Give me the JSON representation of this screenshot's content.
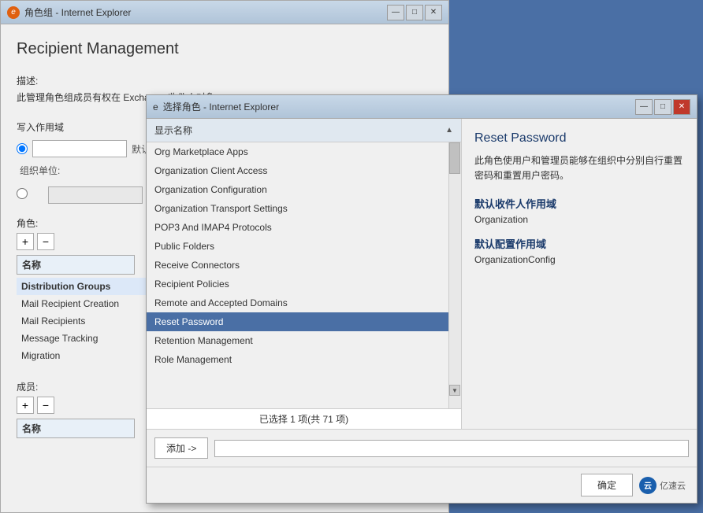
{
  "bg_window": {
    "title": "角色组 - Internet Explorer",
    "ie_icon": "e",
    "content": {
      "heading": "Recipient Management",
      "desc_label": "描述:",
      "desc_text": "此管理角色组成员有权在 Exchange 收件人对象。",
      "write_scope_label": "写入作用域",
      "default_radio": "默认",
      "org_unit_label": "组织单位:",
      "role_label": "角色:",
      "add_symbol": "+",
      "remove_symbol": "−",
      "name_col": "名称",
      "nav_items": [
        {
          "label": "Distribution Groups",
          "active": true
        },
        {
          "label": "Mail Recipient Creation"
        },
        {
          "label": "Mail Recipients"
        },
        {
          "label": "Message Tracking"
        },
        {
          "label": "Migration"
        }
      ],
      "members_label": "成员:",
      "members_add": "+",
      "members_remove": "−",
      "members_name_col": "名称"
    }
  },
  "fg_dialog": {
    "title": "选择角色 - Internet Explorer",
    "ie_icon": "e",
    "list_header": "显示名称",
    "list_items": [
      {
        "label": "Org Marketplace Apps",
        "selected": false
      },
      {
        "label": "Organization Client Access",
        "selected": false
      },
      {
        "label": "Organization Configuration",
        "selected": false
      },
      {
        "label": "Organization Transport Settings",
        "selected": false
      },
      {
        "label": "POP3 And IMAP4 Protocols",
        "selected": false
      },
      {
        "label": "Public Folders",
        "selected": false
      },
      {
        "label": "Receive Connectors",
        "selected": false
      },
      {
        "label": "Recipient Policies",
        "selected": false
      },
      {
        "label": "Remote and Accepted Domains",
        "selected": false
      },
      {
        "label": "Reset Password",
        "selected": true
      },
      {
        "label": "Retention Management",
        "selected": false
      },
      {
        "label": "Role Management",
        "selected": false
      }
    ],
    "status_text": "已选择 1 项(共 71 项)",
    "add_button": "添加 ->",
    "add_input_value": "",
    "confirm_button": "确定",
    "logo_text": "亿速云",
    "right_panel": {
      "title": "Reset Password",
      "desc": "此角色使用户和管理员能够在组织中分别自行重置密码和重置用户密码。",
      "default_recipient_scope_title": "默认收件人作用域",
      "default_recipient_scope_value": "Organization",
      "default_config_scope_title": "默认配置作用域",
      "default_config_scope_value": "OrganizationConfig"
    }
  },
  "window_controls": {
    "minimize": "—",
    "maximize": "□",
    "close": "✕"
  }
}
